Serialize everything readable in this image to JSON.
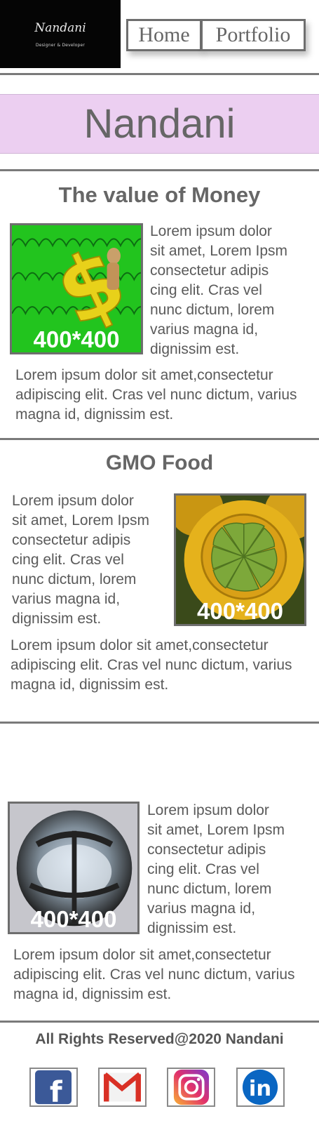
{
  "header": {
    "logo_signature": "Nandani",
    "logo_tagline": "Designer & Developer",
    "nav": [
      {
        "label": "Home"
      },
      {
        "label": "Portfolio"
      }
    ]
  },
  "banner": {
    "name": "Nandani"
  },
  "articles": [
    {
      "title": "The value of Money",
      "image_label": "400*400",
      "side_text": "Lorem ipsum dolor\nsit amet, Lorem Ipsm\nconsectetur adipis\ncing elit. Cras vel\n nunc dictum, lorem\nvarius magna id,\n dignissim est.",
      "body_text": "Lorem ipsum dolor sit amet,consectetur adipiscing elit. Cras vel nunc dictum, varius magna id, dignissim est."
    },
    {
      "title": "GMO Food",
      "image_label": "400*400",
      "side_text": "Lorem ipsum dolor\nsit amet, Lorem Ipsm\nconsectetur adipis\ncing elit. Cras vel\n nunc dictum, lorem\nvarius magna id,\n dignissim est.",
      "body_text": "Lorem ipsum dolor sit amet,consectetur adipiscing elit. Cras vel nunc dictum, varius magna id, dignissim est."
    },
    {
      "title": "",
      "image_label": "400*400",
      "side_text": "Lorem ipsum dolor\nsit amet, Lorem Ipsm\nconsectetur adipis\ncing elit. Cras vel\n nunc dictum, lorem\nvarius magna id,\n dignissim est.",
      "body_text": "Lorem ipsum dolor sit amet,consectetur adipiscing elit. Cras vel nunc dictum, varius magna id, dignissim est."
    }
  ],
  "footer": {
    "copyright": "All Rights Reserved@2020 Nandani",
    "social": [
      {
        "icon": "facebook-icon",
        "letter": "f",
        "color": "#3b5998"
      },
      {
        "icon": "gmail-icon",
        "letter": "M",
        "color": "#d93025"
      },
      {
        "icon": "instagram-icon",
        "letter": "",
        "color": "#c13584"
      },
      {
        "icon": "linkedin-icon",
        "letter": "in",
        "color": "#0a66c2"
      }
    ]
  },
  "colors": {
    "banner_bg": "#eccff1",
    "divider": "#7a7a7a",
    "text": "#5a5a5a"
  }
}
